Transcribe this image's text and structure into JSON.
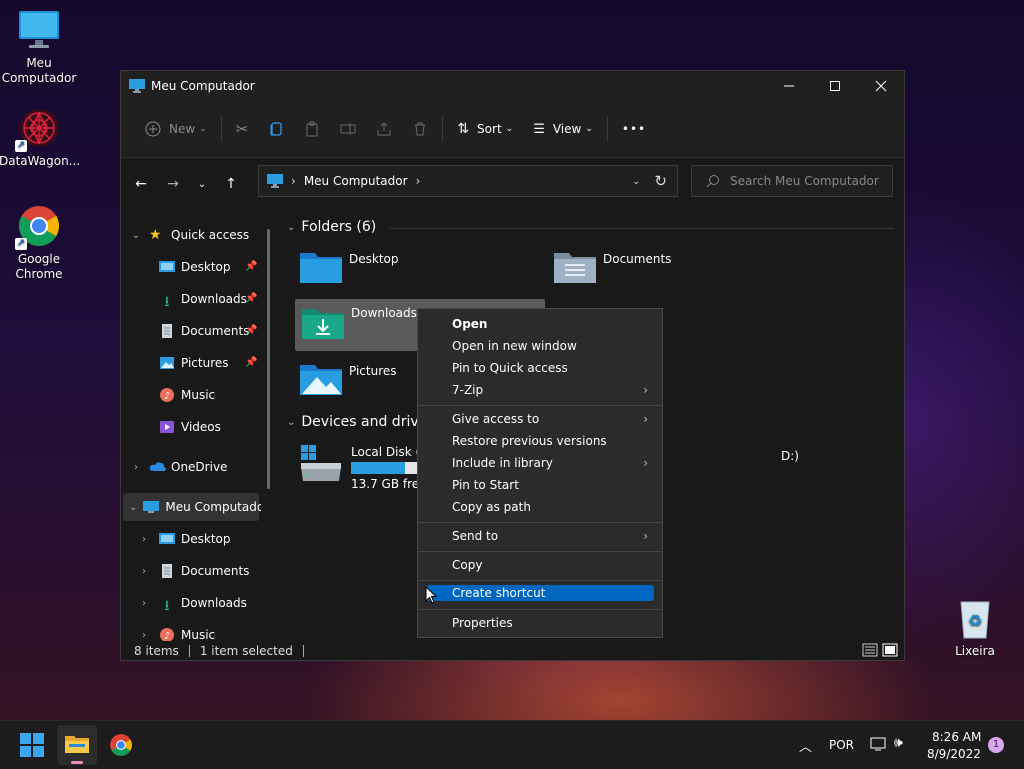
{
  "desktop": {
    "icons": [
      {
        "label": "Meu\nComputador",
        "l1": "Meu",
        "l2": "Computador"
      },
      {
        "label": "DataWagon...",
        "l1": "DataWagon...",
        "l2": ""
      },
      {
        "label": "Google Chrome",
        "l1": "Google",
        "l2": "Chrome"
      },
      {
        "label": "Lixeira",
        "l1": "Lixeira",
        "l2": ""
      }
    ]
  },
  "window": {
    "title": "Meu Computador",
    "toolbar": {
      "new_label": "New",
      "sort_label": "Sort",
      "view_label": "View",
      "more_label": "•••"
    },
    "address": {
      "path": "Meu Computador",
      "search_placeholder": "Search Meu Computador"
    },
    "sidebar": {
      "quick_access": "Quick access",
      "qa_items": [
        "Desktop",
        "Downloads",
        "Documents",
        "Pictures",
        "Music",
        "Videos"
      ],
      "onedrive": "OneDrive",
      "this_pc": "Meu Computador",
      "pc_items": [
        "Desktop",
        "Documents",
        "Downloads",
        "Music"
      ]
    },
    "content": {
      "folders_header": "Folders (6)",
      "folders": [
        "Desktop",
        "Documents",
        "Downloads",
        "Pictures"
      ],
      "devices_header": "Devices and drives",
      "drive_name": "Local Disk (C:)",
      "drive_free": "13.7 GB free",
      "drive_used_fraction": 0.82,
      "partial_label": "D:)"
    },
    "status": {
      "items": "8 items",
      "selected": "1 item selected"
    }
  },
  "context_menu": {
    "items": [
      {
        "label": "Open"
      },
      {
        "label": "Open in new window"
      },
      {
        "label": "Pin to Quick access"
      },
      {
        "label": "7-Zip"
      },
      {
        "label": "Give access to"
      },
      {
        "label": "Restore previous versions"
      },
      {
        "label": "Include in library"
      },
      {
        "label": "Pin to Start"
      },
      {
        "label": "Copy as path"
      },
      {
        "label": "Send to"
      },
      {
        "label": "Copy"
      },
      {
        "label": "Create shortcut"
      },
      {
        "label": "Properties"
      }
    ],
    "highlighted": "Create shortcut"
  },
  "taskbar": {
    "language": "POR",
    "time": "8:26 AM",
    "date": "8/9/2022",
    "notification_count": "1"
  },
  "colors": {
    "accent": "#0067c0",
    "folder_blue": "#1e90e0",
    "folder_green": "#1aa88a"
  }
}
